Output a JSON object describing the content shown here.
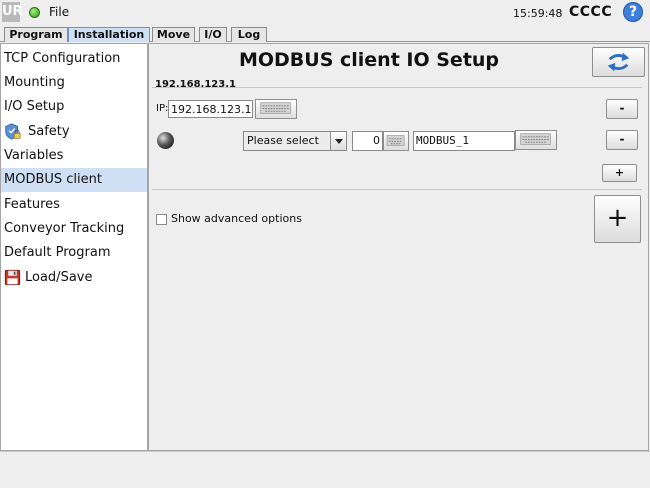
{
  "header": {
    "logo_text": "UR",
    "file_menu": "File",
    "time": "15:59:48",
    "robot_name": "CCCC",
    "help_label": "?"
  },
  "tabs": [
    {
      "label": "Program",
      "active": false
    },
    {
      "label": "Installation",
      "active": true
    },
    {
      "label": "Move",
      "active": false
    },
    {
      "label": "I/O",
      "active": false
    },
    {
      "label": "Log",
      "active": false
    }
  ],
  "sidebar": {
    "items": [
      {
        "label": "TCP Configuration"
      },
      {
        "label": "Mounting"
      },
      {
        "label": "I/O Setup"
      },
      {
        "label": "Safety",
        "icon": "shield-lock-icon"
      },
      {
        "label": "Variables"
      },
      {
        "label": "MODBUS client",
        "active": true
      },
      {
        "label": "Features"
      },
      {
        "label": "Conveyor Tracking"
      },
      {
        "label": "Default Program"
      },
      {
        "label": "Load/Save",
        "icon": "floppy-disk-icon"
      }
    ]
  },
  "main": {
    "title": "MODBUS client IO Setup",
    "server": {
      "name": "192.168.123.1",
      "ip_label": "IP:",
      "ip_value": "192.168.123.1",
      "remove_label": "-"
    },
    "signal": {
      "type_placeholder": "Please select",
      "address": "0",
      "name": "MODBUS_1",
      "remove_label": "-"
    },
    "add_signal_label": "+",
    "advanced_label": "Show advanced options",
    "advanced_checked": false,
    "add_unit_label": "+"
  },
  "colors": {
    "selection": "#cfe0f5",
    "status_green": "#2e9a19",
    "help_blue": "#3d7fd8"
  }
}
